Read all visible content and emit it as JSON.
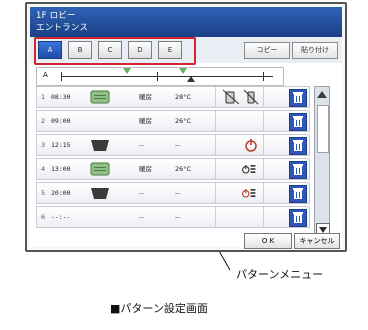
{
  "window": {
    "title_line1": "1F ロビー",
    "title_line2": "エントランス"
  },
  "tabs": [
    {
      "label": "A",
      "active": true
    },
    {
      "label": "B",
      "active": false
    },
    {
      "label": "C",
      "active": false
    },
    {
      "label": "D",
      "active": false
    },
    {
      "label": "E",
      "active": false
    }
  ],
  "toolbar": {
    "copy_label": "コピー",
    "paste_label": "貼り付け"
  },
  "header": {
    "pattern_key": "A"
  },
  "rows": [
    {
      "num": "1",
      "time": "08:30",
      "mode": "暖房",
      "temp": "28°C"
    },
    {
      "num": "2",
      "time": "09:00",
      "mode": "暖房",
      "temp": "26°C"
    },
    {
      "num": "3",
      "time": "12:15",
      "mode": "--",
      "temp": "--"
    },
    {
      "num": "4",
      "time": "13:00",
      "mode": "暖房",
      "temp": "26°C"
    },
    {
      "num": "5",
      "time": "20:00",
      "mode": "--",
      "temp": "--"
    },
    {
      "num": "6",
      "time": "--:--",
      "mode": "--",
      "temp": "--"
    }
  ],
  "buttons": {
    "ok_label": "O K",
    "cancel_label": "キャンセル"
  },
  "annotations": {
    "pattern_menu": "パターンメニュー",
    "screen_caption": "■パターン設定画面"
  },
  "colors": {
    "accent_blue": "#2f63b6",
    "highlight_red": "#d3242f",
    "trash_blue": "#2f56b8"
  }
}
